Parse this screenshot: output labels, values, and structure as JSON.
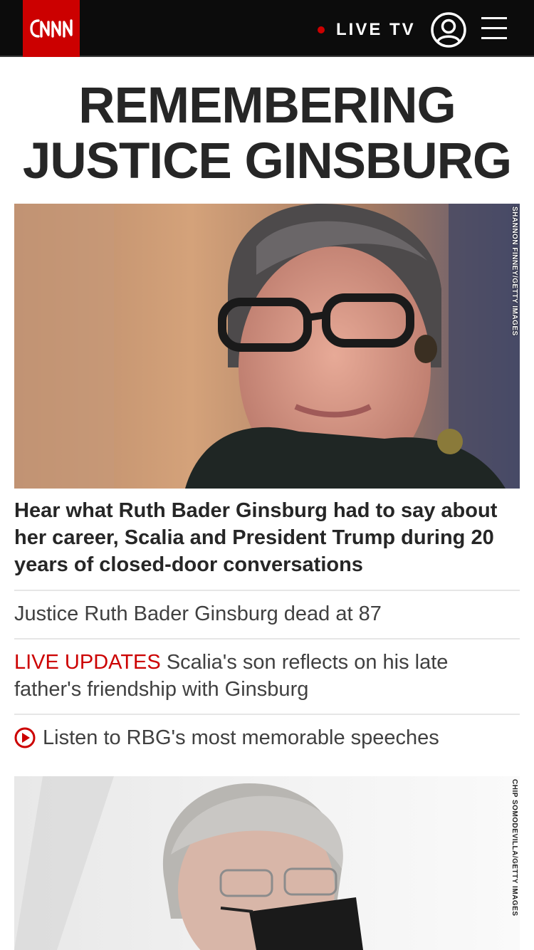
{
  "header": {
    "logo_text": "CNN",
    "live_label": "LIVE TV",
    "account_icon": "user-circle-icon",
    "menu_icon": "hamburger-menu-icon"
  },
  "section": {
    "headline": "REMEMBERING JUSTICE GINSBURG"
  },
  "lead": {
    "photo_credit": "SHANNON FINNEY/GETTY IMAGES",
    "title": "Hear what Ruth Bader Ginsburg had to say about her career, Scalia and President Trump during 20 years of closed-door conversations"
  },
  "links": [
    {
      "text": "Justice Ruth Bader Ginsburg dead at 87"
    },
    {
      "label": "LIVE UPDATES",
      "text": "Scalia's son reflects on his late father's friendship with Ginsburg"
    },
    {
      "text": "Listen to RBG's most memorable speeches",
      "icon": "play-circle-icon"
    }
  ],
  "second_story": {
    "photo_credit": "CHIP SOMODEVILLA/GETTY IMAGES"
  },
  "colors": {
    "brand_red": "#cc0000",
    "topbar": "#0c0c0c",
    "text": "#262626"
  }
}
